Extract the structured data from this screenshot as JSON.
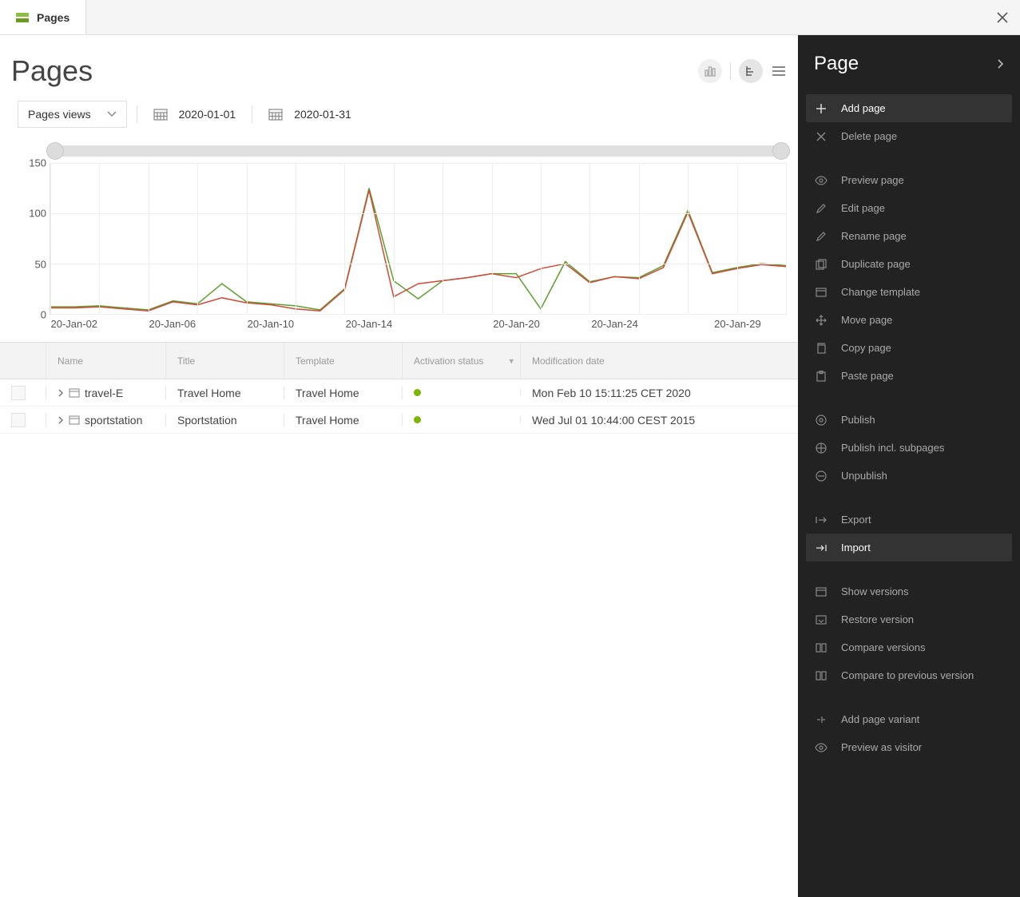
{
  "tab": {
    "label": "Pages"
  },
  "header": {
    "title": "Pages"
  },
  "filters": {
    "metric_label": "Pages views",
    "date_start": "2020-01-01",
    "date_end": "2020-01-31"
  },
  "chart_data": {
    "type": "line",
    "ylim": [
      0,
      150
    ],
    "yticks": [
      0,
      50,
      100,
      150
    ],
    "x_major": [
      "20-Jan-02",
      "20-Jan-06",
      "20-Jan-10",
      "20-Jan-14",
      "20-Jan-20",
      "20-Jan-24",
      "20-Jan-29"
    ],
    "x": [
      "01",
      "02",
      "03",
      "04",
      "05",
      "06",
      "07",
      "08",
      "09",
      "10",
      "11",
      "12",
      "13",
      "14",
      "15",
      "16",
      "17",
      "18",
      "19",
      "20",
      "21",
      "22",
      "23",
      "24",
      "25",
      "26",
      "27",
      "28",
      "29",
      "30",
      "31"
    ],
    "series": [
      {
        "name": "green",
        "color": "#5aa02c",
        "values": [
          7,
          7,
          8,
          6,
          4,
          13,
          10,
          30,
          12,
          10,
          8,
          4,
          25,
          125,
          33,
          15,
          33,
          36,
          40,
          40,
          5,
          52,
          32,
          37,
          36,
          48,
          103,
          41,
          46,
          50,
          48
        ]
      },
      {
        "name": "red",
        "color": "#d24a3a",
        "values": [
          6,
          6,
          7,
          5,
          3,
          12,
          9,
          16,
          11,
          9,
          5,
          3,
          24,
          123,
          17,
          30,
          33,
          36,
          40,
          36,
          45,
          50,
          31,
          37,
          35,
          46,
          101,
          40,
          45,
          49,
          47
        ]
      }
    ]
  },
  "table": {
    "columns": {
      "name": "Name",
      "title": "Title",
      "template": "Template",
      "activation": "Activation status",
      "modification": "Modification date"
    },
    "rows": [
      {
        "name": "travel-E",
        "title": "Travel Home",
        "template": "Travel Home",
        "active": true,
        "modified": "Mon Feb 10 15:11:25 CET 2020"
      },
      {
        "name": "sportstation",
        "title": "Sportstation",
        "template": "Travel Home",
        "active": true,
        "modified": "Wed Jul 01 10:44:00 CEST 2015"
      }
    ]
  },
  "panel": {
    "title": "Page",
    "actions": {
      "add": "Add page",
      "delete": "Delete page",
      "preview": "Preview page",
      "edit": "Edit page",
      "rename": "Rename page",
      "duplicate": "Duplicate page",
      "change_template": "Change template",
      "move": "Move page",
      "copy": "Copy page",
      "paste": "Paste page",
      "publish": "Publish",
      "publish_sub": "Publish incl. subpages",
      "unpublish": "Unpublish",
      "export": "Export",
      "import": "Import",
      "show_versions": "Show versions",
      "restore_version": "Restore version",
      "compare_versions": "Compare versions",
      "compare_prev": "Compare to previous version",
      "add_variant": "Add page variant",
      "preview_visitor": "Preview as visitor"
    }
  }
}
